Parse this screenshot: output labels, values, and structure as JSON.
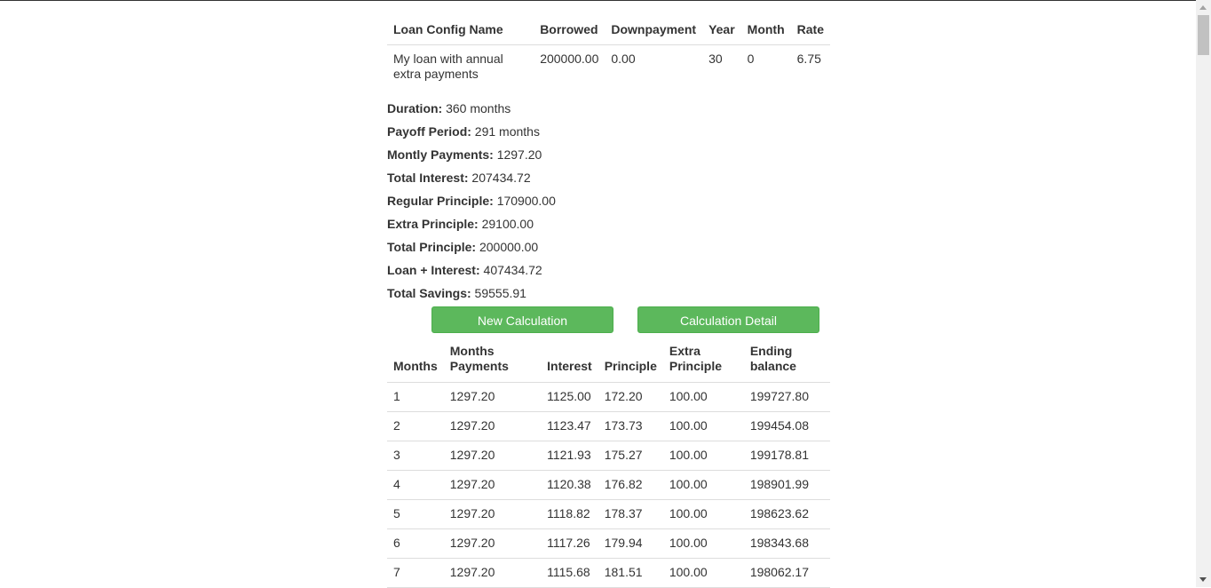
{
  "config_table": {
    "headers": [
      "Loan Config Name",
      "Borrowed",
      "Downpayment",
      "Year",
      "Month",
      "Rate"
    ],
    "row": [
      "My loan with annual extra payments",
      "200000.00",
      "0.00",
      "30",
      "0",
      "6.75"
    ]
  },
  "summary": [
    {
      "label": "Duration:",
      "value": "360 months"
    },
    {
      "label": "Payoff Period:",
      "value": "291 months"
    },
    {
      "label": "Montly Payments:",
      "value": "1297.20"
    },
    {
      "label": "Total Interest:",
      "value": "207434.72"
    },
    {
      "label": "Regular Principle:",
      "value": "170900.00"
    },
    {
      "label": "Extra Principle:",
      "value": "29100.00"
    },
    {
      "label": "Total Principle:",
      "value": "200000.00"
    },
    {
      "label": "Loan + Interest:",
      "value": "407434.72"
    },
    {
      "label": "Total Savings:",
      "value": "59555.91"
    }
  ],
  "buttons": {
    "new_calculation": "New Calculation",
    "calculation_detail": "Calculation Detail"
  },
  "detail_table": {
    "headers": [
      "Months",
      "Months Payments",
      "Interest",
      "Principle",
      "Extra Principle",
      "Ending balance"
    ],
    "rows": [
      [
        "1",
        "1297.20",
        "1125.00",
        "172.20",
        "100.00",
        "199727.80"
      ],
      [
        "2",
        "1297.20",
        "1123.47",
        "173.73",
        "100.00",
        "199454.08"
      ],
      [
        "3",
        "1297.20",
        "1121.93",
        "175.27",
        "100.00",
        "199178.81"
      ],
      [
        "4",
        "1297.20",
        "1120.38",
        "176.82",
        "100.00",
        "198901.99"
      ],
      [
        "5",
        "1297.20",
        "1118.82",
        "178.37",
        "100.00",
        "198623.62"
      ],
      [
        "6",
        "1297.20",
        "1117.26",
        "179.94",
        "100.00",
        "198343.68"
      ],
      [
        "7",
        "1297.20",
        "1115.68",
        "181.51",
        "100.00",
        "198062.17"
      ]
    ]
  },
  "colors": {
    "button_green": "#5cb85c",
    "button_border": "#4cae4c",
    "text": "#333333",
    "divider": "#dddddd"
  }
}
